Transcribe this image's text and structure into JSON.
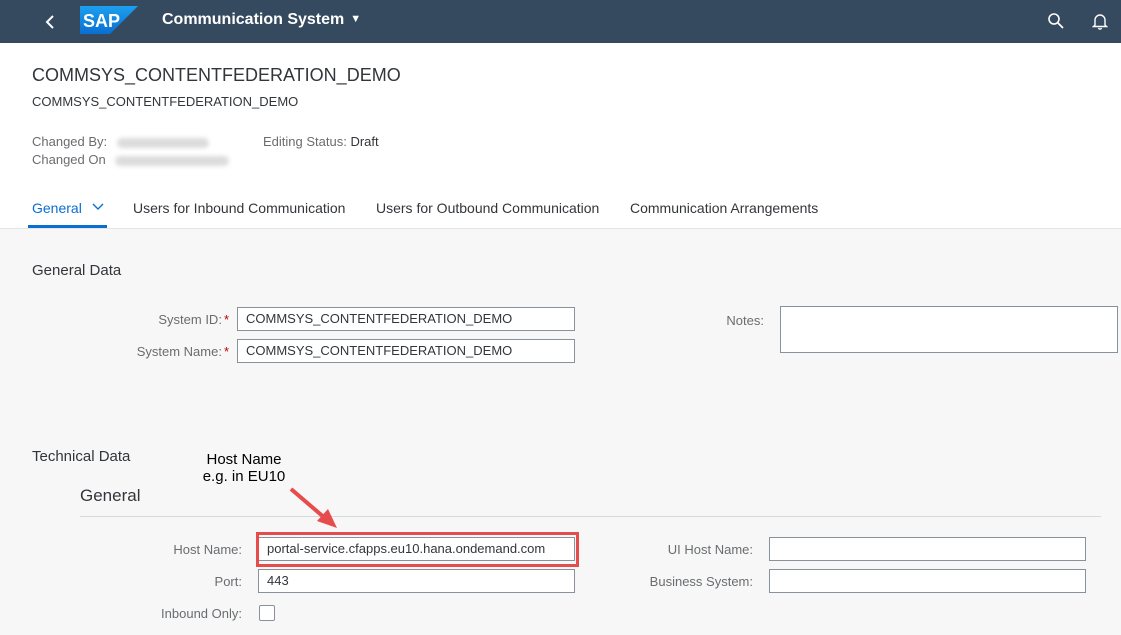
{
  "shell": {
    "logo_text": "SAP",
    "app_title": "Communication System",
    "colors": {
      "shell_bg": "#354a5f",
      "logo_blue": "#0a6ed1",
      "accent": "#0a6ed1",
      "callout_red": "#e74c4c"
    }
  },
  "header": {
    "title": "COMMSYS_CONTENTFEDERATION_DEMO",
    "subtitle": "COMMSYS_CONTENTFEDERATION_DEMO",
    "changed_by_label": "Changed By:",
    "changed_on_label": "Changed On",
    "editing_status_label": "Editing Status:",
    "editing_status_value": "Draft"
  },
  "tabs": [
    {
      "label": "General"
    },
    {
      "label": "Users for Inbound Communication"
    },
    {
      "label": "Users for Outbound Communication"
    },
    {
      "label": "Communication Arrangements"
    }
  ],
  "general_data": {
    "section_title": "General Data",
    "system_id_label": "System ID:",
    "system_id_value": "COMMSYS_CONTENTFEDERATION_DEMO",
    "system_name_label": "System Name:",
    "system_name_value": "COMMSYS_CONTENTFEDERATION_DEMO",
    "notes_label": "Notes:",
    "required_mark": "*"
  },
  "technical_data": {
    "section_title": "Technical Data",
    "subsection_title": "General",
    "host_name_label": "Host Name:",
    "host_name_value": "portal-service.cfapps.eu10.hana.ondemand.com",
    "port_label": "Port:",
    "port_value": "443",
    "inbound_only_label": "Inbound Only:",
    "ui_host_name_label": "UI Host Name:",
    "business_system_label": "Business System:"
  },
  "annotation": {
    "line1": "Host Name",
    "line2": "e.g. in EU10"
  }
}
